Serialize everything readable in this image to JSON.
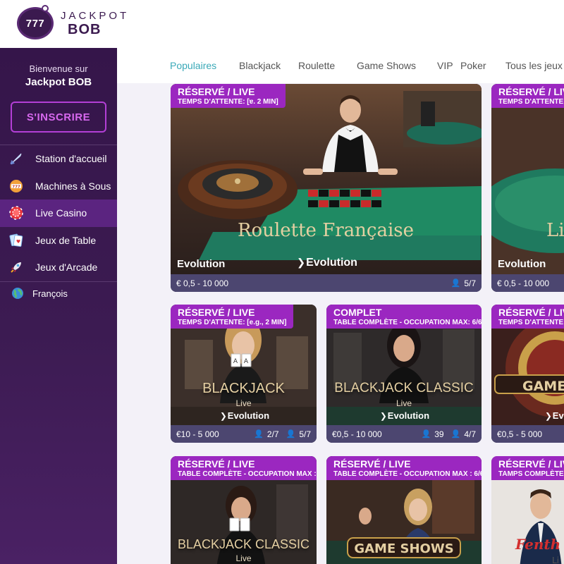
{
  "header": {
    "logo_badge": "777",
    "logo_top": "JACKPOT",
    "logo_bottom": "BOB"
  },
  "sidebar": {
    "welcome_line": "Bienvenue sur",
    "welcome_brand": "Jackpot BOB",
    "signup_label": "S'INSCRIRE",
    "items": [
      {
        "label": "Station d'accueil",
        "icon": "sword-icon"
      },
      {
        "label": "Machines à Sous",
        "icon": "slot-icon"
      },
      {
        "label": "Live Casino",
        "icon": "chip-icon",
        "active": true
      },
      {
        "label": "Jeux de Table",
        "icon": "cards-icon"
      },
      {
        "label": "Jeux d'Arcade",
        "icon": "rocket-icon"
      }
    ],
    "language": {
      "label": "François",
      "icon": "globe-icon"
    }
  },
  "tabs": [
    {
      "label": "Populaires",
      "active": true
    },
    {
      "label": "Blackjack"
    },
    {
      "label": "Roulette"
    },
    {
      "label": "Game Shows"
    },
    {
      "label": "VIP"
    },
    {
      "label": "Poker"
    },
    {
      "label": "Tous les jeux"
    }
  ],
  "cards": {
    "roulette": {
      "badge_title": "RÉSERVÉ / LIVE",
      "badge_sub": "TEMPS D'ATTENTE: [ɐ. 2 MIN]",
      "title": "Roulette Française",
      "provider_left": "Evolution",
      "provider_logo": "Evolution",
      "limits": "€ 0,5 - 10 000",
      "players": "5/7"
    },
    "right_top": {
      "badge_title": "RÉSERVÉ / LIV",
      "badge_sub": "TEMPS D'ATTENTE:",
      "title": "Li",
      "provider_left": "Evolution",
      "limits": "€ 0,5 - 10 000"
    },
    "blackjack": {
      "badge_title": "RÉSERVÉ / LIVE",
      "badge_sub": "TEMPS D'ATTENTE: [e.g., 2 MIN]",
      "title": "BLACKJACK",
      "subtitle": "Live",
      "provider_logo": "Evolution",
      "limits": "€10 - 5 000",
      "viewers": "2/7",
      "players": "5/7"
    },
    "blackjack_classic": {
      "badge_title": "COMPLET",
      "badge_sub": "TABLE COMPLÈTE - OCCUPATION MAX: 6/6]",
      "title": "BLACKJACK CLASSIC",
      "subtitle": "Live",
      "provider_logo": "Evolution",
      "limits": "€0,5 - 10 000",
      "viewers": "39",
      "players": "4/7"
    },
    "right_mid": {
      "badge_title": "RÉSERVÉ / LIV",
      "badge_sub": "TEMPS D'ATTENTE:",
      "title": "GAME",
      "provider_logo": "Evo",
      "limits": "€0,5 - 5 000"
    },
    "bj_classic_2": {
      "badge_title": "RÉSERVÉ / LIVE",
      "badge_sub": "TABLE COMPLÈTE - OCCUPATION MAX : 1",
      "title": "BLACKJACK CLASSIC",
      "subtitle": "Live"
    },
    "game_shows": {
      "badge_title": "RÉSERVÉ / LIVE",
      "badge_sub": "TABLE COMPLÈTE - OCCUPATION MAX : 6/6]",
      "title": "GAME SHOWS"
    },
    "right_bottom": {
      "badge_title": "RÉSERVÉ / LIV",
      "badge_sub": "TAMPS COMPLÈTE -",
      "title": "Fenth",
      "subtitle": "Li"
    }
  },
  "colors": {
    "sidebar": "#3c1b52",
    "accent": "#9b27c0",
    "tab_active": "#3aa9b8",
    "card_bar": "#4c4670"
  }
}
